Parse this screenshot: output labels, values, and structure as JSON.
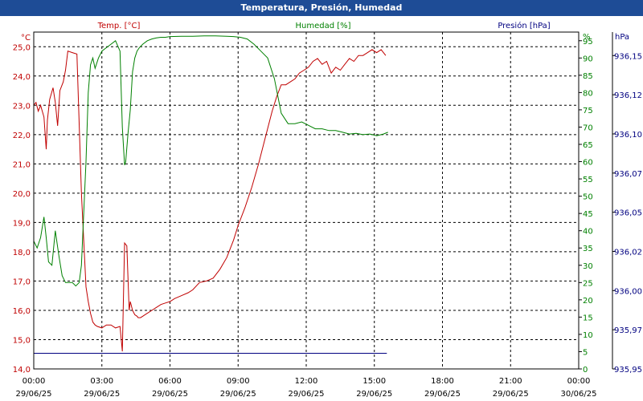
{
  "window": {
    "title": "Temperatura, Presión, Humedad"
  },
  "colors": {
    "temperature": "#c00000",
    "humidity": "#008000",
    "pressure": "#000080",
    "titlebar": "#1e4c96"
  },
  "headers": {
    "temp": "Temp. [°C]",
    "hum": "Humedad [%]",
    "pres": "Presión [hPa]"
  },
  "units": {
    "temp": "°C",
    "hum": "%",
    "pres": "hPa"
  },
  "chart_data": {
    "type": "line",
    "title": "Temperatura, Presión, Humedad",
    "grid": true,
    "x_ticks": [
      {
        "t": "00:00",
        "d": "29/06/25"
      },
      {
        "t": "03:00",
        "d": "29/06/25"
      },
      {
        "t": "06:00",
        "d": "29/06/25"
      },
      {
        "t": "09:00",
        "d": "29/06/25"
      },
      {
        "t": "12:00",
        "d": "29/06/25"
      },
      {
        "t": "15:00",
        "d": "29/06/25"
      },
      {
        "t": "18:00",
        "d": "29/06/25"
      },
      {
        "t": "21:00",
        "d": "29/06/25"
      },
      {
        "t": "00:00",
        "d": "30/06/25"
      }
    ],
    "xlim_hours": [
      0,
      24
    ],
    "axes": {
      "temp": {
        "min": 14,
        "max": 25.5,
        "ticks": [
          "14,0",
          "15,0",
          "16,0",
          "17,0",
          "18,0",
          "19,0",
          "20,0",
          "21,0",
          "22,0",
          "23,0",
          "24,0",
          "25,0"
        ],
        "tick_values": [
          14,
          15,
          16,
          17,
          18,
          19,
          20,
          21,
          22,
          23,
          24,
          25
        ]
      },
      "hum": {
        "min": 0,
        "max": 97.5,
        "ticks": [
          "0",
          "5",
          "10",
          "15",
          "20",
          "25",
          "30",
          "35",
          "40",
          "45",
          "50",
          "55",
          "60",
          "65",
          "70",
          "75",
          "80",
          "85",
          "90",
          "95"
        ],
        "tick_values": [
          0,
          5,
          10,
          15,
          20,
          25,
          30,
          35,
          40,
          45,
          50,
          55,
          60,
          65,
          70,
          75,
          80,
          85,
          90,
          95
        ]
      },
      "pres": {
        "min": 935.95,
        "max": 936.165,
        "ticks": [
          "935,95",
          "935,97",
          "936,00",
          "936,02",
          "936,05",
          "936,07",
          "936,10",
          "936,12",
          "936,15"
        ],
        "tick_values": [
          935.95,
          935.975,
          936.0,
          936.025,
          936.05,
          936.075,
          936.1,
          936.125,
          936.15
        ]
      }
    },
    "series": [
      {
        "name": "Temp. [°C]",
        "axis": "temp",
        "color": "#c00000",
        "x": [
          0,
          0.1,
          0.2,
          0.3,
          0.45,
          0.55,
          0.6,
          0.7,
          0.85,
          0.95,
          1.05,
          1.15,
          1.3,
          1.4,
          1.5,
          1.7,
          1.9,
          2.1,
          2.3,
          2.4,
          2.5,
          2.6,
          2.7,
          2.8,
          3.0,
          3.2,
          3.4,
          3.6,
          3.8,
          3.9,
          4.0,
          4.1,
          4.2,
          4.25,
          4.35,
          4.45,
          4.55,
          4.6,
          4.7,
          4.8,
          4.9,
          5.0,
          5.2,
          5.4,
          5.6,
          5.8,
          6.0,
          6.2,
          6.5,
          6.8,
          7.0,
          7.3,
          7.6,
          7.9,
          8.2,
          8.5,
          8.8,
          9.0,
          9.3,
          9.6,
          9.9,
          10.2,
          10.5,
          10.7,
          10.9,
          11.1,
          11.3,
          11.5,
          11.7,
          11.9,
          12.1,
          12.3,
          12.5,
          12.7,
          12.9,
          13.1,
          13.3,
          13.5,
          13.7,
          13.9,
          14.1,
          14.3,
          14.5,
          14.7,
          14.9,
          15.1,
          15.3,
          15.5
        ],
        "y": [
          23.0,
          23.1,
          22.8,
          23.0,
          22.6,
          21.5,
          22.5,
          23.2,
          23.6,
          23.1,
          22.3,
          23.5,
          23.8,
          24.2,
          24.85,
          24.8,
          24.75,
          20.0,
          16.8,
          16.3,
          15.9,
          15.6,
          15.5,
          15.45,
          15.4,
          15.5,
          15.5,
          15.4,
          15.45,
          14.6,
          18.3,
          18.2,
          16.0,
          16.3,
          16.0,
          15.85,
          15.8,
          15.75,
          15.75,
          15.8,
          15.85,
          15.9,
          16.0,
          16.1,
          16.2,
          16.25,
          16.3,
          16.4,
          16.5,
          16.6,
          16.7,
          16.95,
          17.0,
          17.1,
          17.4,
          17.8,
          18.4,
          18.9,
          19.5,
          20.2,
          21.0,
          21.9,
          22.8,
          23.3,
          23.7,
          23.7,
          23.8,
          23.9,
          24.1,
          24.2,
          24.3,
          24.5,
          24.6,
          24.4,
          24.5,
          24.1,
          24.3,
          24.2,
          24.4,
          24.6,
          24.5,
          24.7,
          24.7,
          24.8,
          24.9,
          24.8,
          24.9,
          24.7
        ]
      },
      {
        "name": "Humedad [%]",
        "axis": "hum",
        "color": "#008000",
        "x": [
          0,
          0.15,
          0.3,
          0.45,
          0.55,
          0.65,
          0.8,
          0.95,
          1.1,
          1.25,
          1.4,
          1.55,
          1.7,
          1.85,
          2.0,
          2.1,
          2.3,
          2.4,
          2.5,
          2.6,
          2.7,
          2.85,
          3.0,
          3.2,
          3.4,
          3.6,
          3.8,
          3.9,
          4.0,
          4.05,
          4.15,
          4.25,
          4.35,
          4.45,
          4.55,
          4.65,
          4.8,
          5.0,
          5.2,
          5.4,
          5.6,
          5.8,
          6.0,
          6.5,
          7.0,
          7.5,
          8.0,
          8.5,
          8.8,
          9.1,
          9.4,
          9.7,
          10.0,
          10.3,
          10.6,
          10.9,
          11.2,
          11.5,
          11.8,
          12.1,
          12.4,
          12.7,
          13.0,
          13.3,
          13.6,
          13.9,
          14.2,
          14.5,
          14.8,
          15.1,
          15.4,
          15.6
        ],
        "y": [
          37,
          35,
          38,
          44,
          38,
          31,
          30,
          40,
          33,
          27,
          25,
          25,
          25,
          24,
          25,
          30,
          60,
          80,
          88,
          90,
          87,
          90,
          92,
          93,
          94,
          95,
          92,
          70,
          59,
          60,
          68,
          75,
          86,
          90,
          92,
          93,
          94,
          95,
          95.5,
          95.8,
          96,
          96,
          96.2,
          96.3,
          96.3,
          96.4,
          96.4,
          96.3,
          96.2,
          96.0,
          95.5,
          94.0,
          92,
          90,
          84,
          74,
          71,
          71,
          71.5,
          70.5,
          69.5,
          69.5,
          69,
          69,
          68.5,
          68,
          68.2,
          67.8,
          68,
          67.5,
          68,
          68.5
        ]
      },
      {
        "name": "Presión [hPa]",
        "axis": "pres",
        "color": "#000080",
        "x": [
          0,
          15.55
        ],
        "y": [
          935.96,
          935.96
        ]
      }
    ]
  }
}
